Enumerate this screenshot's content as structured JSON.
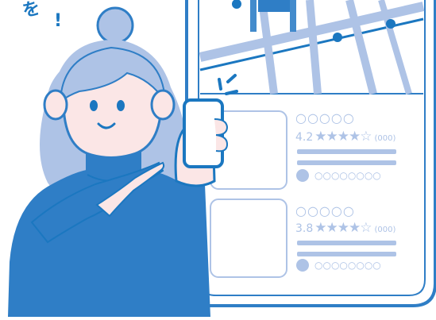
{
  "illustration": {
    "caption_fragment": "を",
    "caption_exclaim": "!",
    "colors": {
      "primary_blue": "#2f7ec6",
      "dark_outline": "#1b77c0",
      "light_blue": "#aec3e6",
      "pale_blue": "#cddcf1",
      "skin": "#fbe6e6",
      "white": "#ffffff"
    }
  },
  "listings": [
    {
      "name": "○○○○○",
      "rating": "4.2",
      "stars": "★★★★☆",
      "review_count": "(000)",
      "address": "○○○○○○○○"
    },
    {
      "name": "○○○○○",
      "rating": "3.8",
      "stars": "★★★★☆",
      "review_count": "(000)",
      "address": "○○○○○○○○"
    }
  ]
}
